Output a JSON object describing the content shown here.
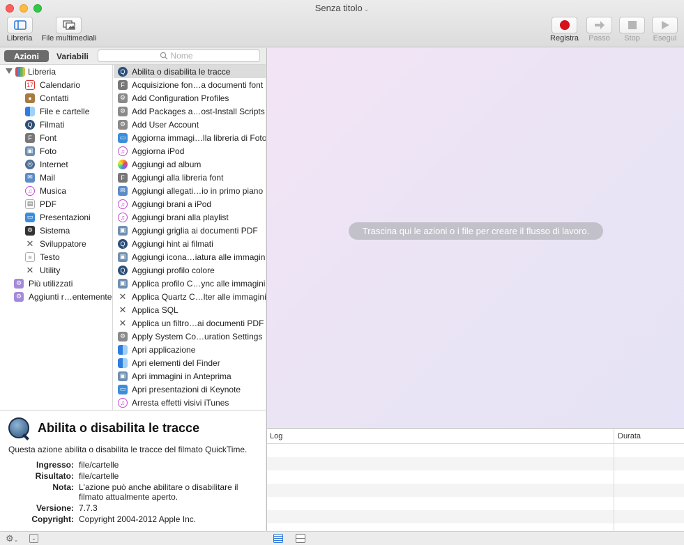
{
  "window": {
    "title": "Senza titolo"
  },
  "toolbar": {
    "library_label": "Libreria",
    "media_label": "File multimediali",
    "record_label": "Registra",
    "step_label": "Passo",
    "stop_label": "Stop",
    "run_label": "Esegui"
  },
  "tabs": {
    "actions": "Azioni",
    "variables": "Variabili"
  },
  "search": {
    "placeholder": "Nome"
  },
  "categories": {
    "root": "Libreria",
    "items": [
      "Calendario",
      "Contatti",
      "File e cartelle",
      "Filmati",
      "Font",
      "Foto",
      "Internet",
      "Mail",
      "Musica",
      "PDF",
      "Presentazioni",
      "Sistema",
      "Sviluppatore",
      "Testo",
      "Utility"
    ],
    "groups": [
      "Più utilizzati",
      "Aggiunti r…entemente"
    ]
  },
  "actions": [
    "Abilita o disabilita le tracce",
    "Acquisizione fon…a documenti font",
    "Add Configuration Profiles",
    "Add Packages a…ost-Install Scripts",
    "Add User Account",
    "Aggiorna immagi…lla libreria di Foto",
    "Aggiorna iPod",
    "Aggiungi ad album",
    "Aggiungi alla libreria font",
    "Aggiungi allegati…io in primo piano",
    "Aggiungi brani a iPod",
    "Aggiungi brani alla playlist",
    "Aggiungi griglia ai documenti PDF",
    "Aggiungi hint ai filmati",
    "Aggiungi icona…iatura alle immagini",
    "Aggiungi profilo colore",
    "Applica profilo C…ync alle immagini",
    "Applica Quartz C…lter alle immagini",
    "Applica SQL",
    "Applica un filtro…ai documenti PDF",
    "Apply System Co…uration Settings",
    "Apri applicazione",
    "Apri elementi del Finder",
    "Apri immagini in Anteprima",
    "Apri presentazioni di Keynote",
    "Arresta effetti visivi iTunes"
  ],
  "info": {
    "title": "Abilita o disabilita le tracce",
    "description": "Questa azione abilita o disabilita le tracce del filmato QuickTime.",
    "input_key": "Ingresso:",
    "input_val": "file/cartelle",
    "result_key": "Risultato:",
    "result_val": "file/cartelle",
    "note_key": "Nota:",
    "note_val": "L'azione può anche abilitare o disabilitare il filmato attualmente aperto.",
    "version_key": "Versione:",
    "version_val": "7.7.3",
    "copyright_key": "Copyright:",
    "copyright_val": "Copyright 2004-2012 Apple Inc."
  },
  "workflow": {
    "drop_hint": "Trascina qui le azioni o i file per creare il flusso di lavoro."
  },
  "log": {
    "col_log": "Log",
    "col_duration": "Durata"
  }
}
